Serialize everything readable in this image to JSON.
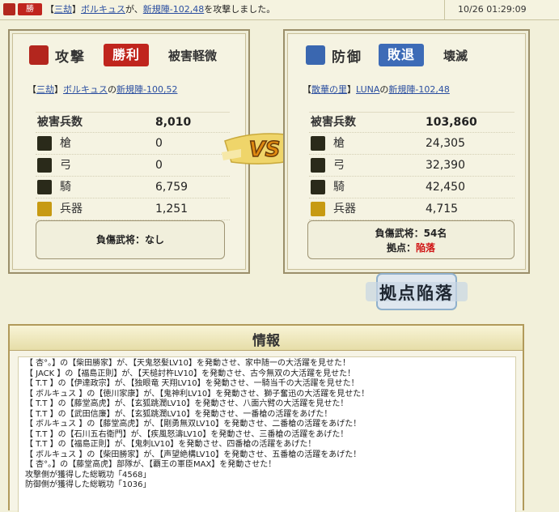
{
  "notification": {
    "badge": "勝",
    "message_parts": {
      "prefix": "【",
      "alliance": "三劫",
      "mid": "】",
      "player": "ボルキュス",
      "verb": "が、",
      "target": "新規陣-102,48",
      "suffix": "を攻撃しました。"
    },
    "timestamp": "10/26 01:29:09"
  },
  "attacker": {
    "title": "攻撃",
    "result": "勝利",
    "damage": "被害軽微",
    "commander": {
      "open": "【",
      "alliance": "三劫",
      "close": "】",
      "player": "ボルキュス",
      "particle": "の",
      "base": "新規陣-100,52"
    },
    "stats": {
      "total_label": "被害兵数",
      "total": "8,010",
      "rows": [
        {
          "label": "槍",
          "value": "0",
          "icon": "spear-icon"
        },
        {
          "label": "弓",
          "value": "0",
          "icon": "bow-icon"
        },
        {
          "label": "騎",
          "value": "6,759",
          "icon": "horse-icon"
        },
        {
          "label": "兵器",
          "value": "1,251",
          "icon": "siege-weapon-icon"
        }
      ]
    },
    "injured": "負傷武将：なし"
  },
  "defender": {
    "title": "防御",
    "result": "敗退",
    "damage": "壊滅",
    "commander": {
      "open": "【",
      "alliance": "散華の里",
      "close": "】",
      "player": "LUNA",
      "particle": "の",
      "base": "新規陣-102,48"
    },
    "stats": {
      "total_label": "被害兵数",
      "total": "103,860",
      "rows": [
        {
          "label": "槍",
          "value": "24,305",
          "icon": "spear-icon"
        },
        {
          "label": "弓",
          "value": "32,390",
          "icon": "bow-icon"
        },
        {
          "label": "騎",
          "value": "42,450",
          "icon": "horse-icon"
        },
        {
          "label": "兵器",
          "value": "4,715",
          "icon": "siege-weapon-icon"
        }
      ]
    },
    "injured": "負傷武将：54名",
    "base_label": "拠点：",
    "base_status": "陥落"
  },
  "vs_label": "VS",
  "stamp_label": "拠点陥落",
  "info": {
    "title": "情報",
    "log": [
      "【 杏°。】の【柴田勝家】が、【天鬼怒髪LV10】を発動させ、家中随一の大活躍を見せた！",
      "【 JACK 】の【福島正則】が、【天槌討杵LV10】を発動させ、古今無双の大活躍を見せた！",
      "【 T.T 】の【伊達政宗】が、【独眼竜 天翔LV10】を発動させ、一騎当千の大活躍を見せた！",
      "【 ボルキュス 】の【徳川家康】が、【鬼神利LV10】を発動させ、獅子奮迅の大活躍を見せた！",
      "【 T.T 】の【藤堂高虎】が、【玄狐跳濶LV10】を発動させ、八面六臂の大活躍を見せた！",
      "【 T.T 】の【武田信廉】が、【玄狐跳濶LV10】を発動させ、一番槍の活躍をあげた！",
      "【 ボルキュス 】の【藤堂高虎】が、【剛勇無双LV10】を発動させ、二番槍の活躍をあげた！",
      "【 T.T 】の【石川五右衛門】が、【疾風怒濤LV10】を発動させ、三番槍の活躍をあげた！",
      "【 T.T 】の【福島正則】が、【鬼刺LV10】を発動させ、四番槍の活躍をあげた！",
      "【 ボルキュス 】の【柴田勝家】が、【声望絶構LV10】を発動させ、五番槍の活躍をあげた！",
      "【 杏°。】の【藤堂高虎】部隊が、【覇王の軍臣MAX】を発動させた！",
      "攻撃側が獲得した総戦功「4568」",
      "防御側が獲得した総戦功「1036」"
    ]
  },
  "colors": {
    "win_red": "#c0251d",
    "lose_blue": "#3d6bb7",
    "fallen_red": "#d01414",
    "link_blue": "#2a4ea0"
  }
}
